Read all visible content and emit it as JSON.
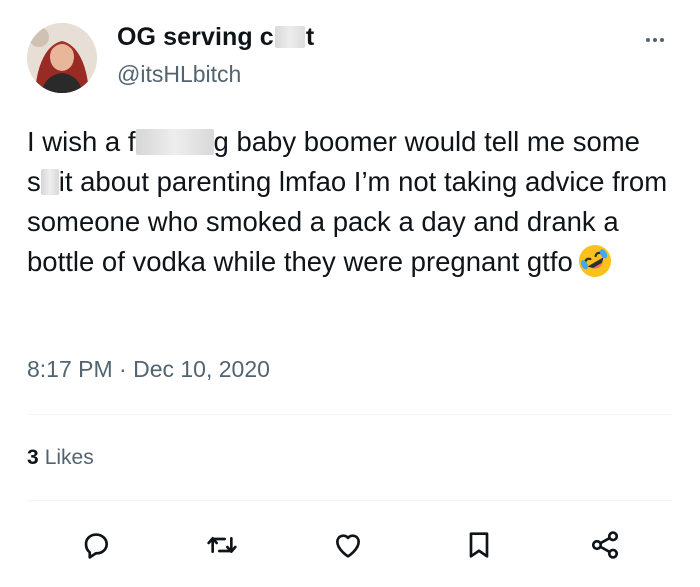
{
  "author": {
    "display_name_start": "OG serving c",
    "display_name_end": "t",
    "handle": "@itsHLbitch"
  },
  "tweet": {
    "segments": {
      "s1": "I wish a f",
      "s2": "g baby boomer would tell me some",
      "s3": "s",
      "s4": "it about parenting lmfao I’m not taking advice from someone who smoked a pack a day and drank a bottle of vodka while they were pregnant gtfo"
    },
    "emoji": "rolling-on-floor-laughing-emoji"
  },
  "timestamp": "8:17 PM · Dec 10, 2020",
  "likes": {
    "count": "3",
    "label": "Likes"
  },
  "actions": [
    "reply-icon",
    "retweet-icon",
    "like-icon",
    "bookmark-icon",
    "share-icon"
  ],
  "colors": {
    "text": "#0f1419",
    "secondary": "#536471",
    "divider": "#eff3f4"
  }
}
